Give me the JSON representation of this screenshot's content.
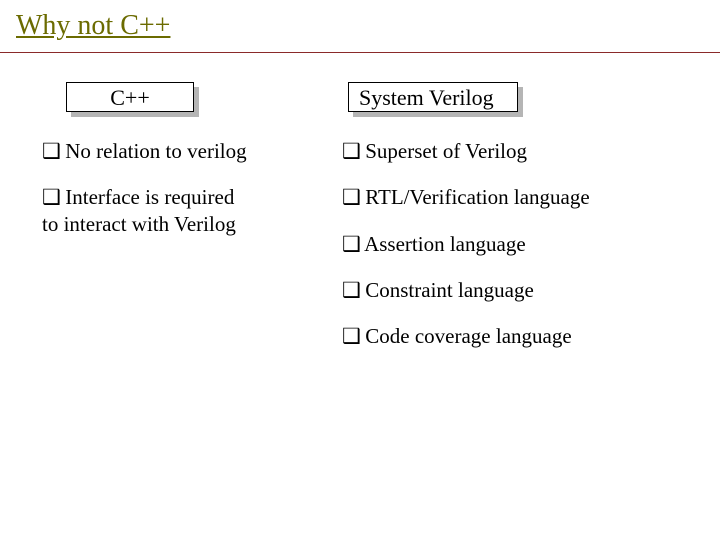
{
  "title": "Why not C++",
  "bullet": "❑",
  "headers": {
    "left": "C++",
    "right": "System Verilog"
  },
  "left_items": [
    {
      "line1": "No relation to verilog"
    },
    {
      "line1": "Interface is required",
      "line2": "to interact with Verilog"
    }
  ],
  "right_items": [
    {
      "line1": "Superset of Verilog"
    },
    {
      "line1": "RTL/Verification language"
    },
    {
      "line1": "Assertion language"
    },
    {
      "line1": "Constraint language"
    },
    {
      "line1": "Code coverage language"
    }
  ]
}
